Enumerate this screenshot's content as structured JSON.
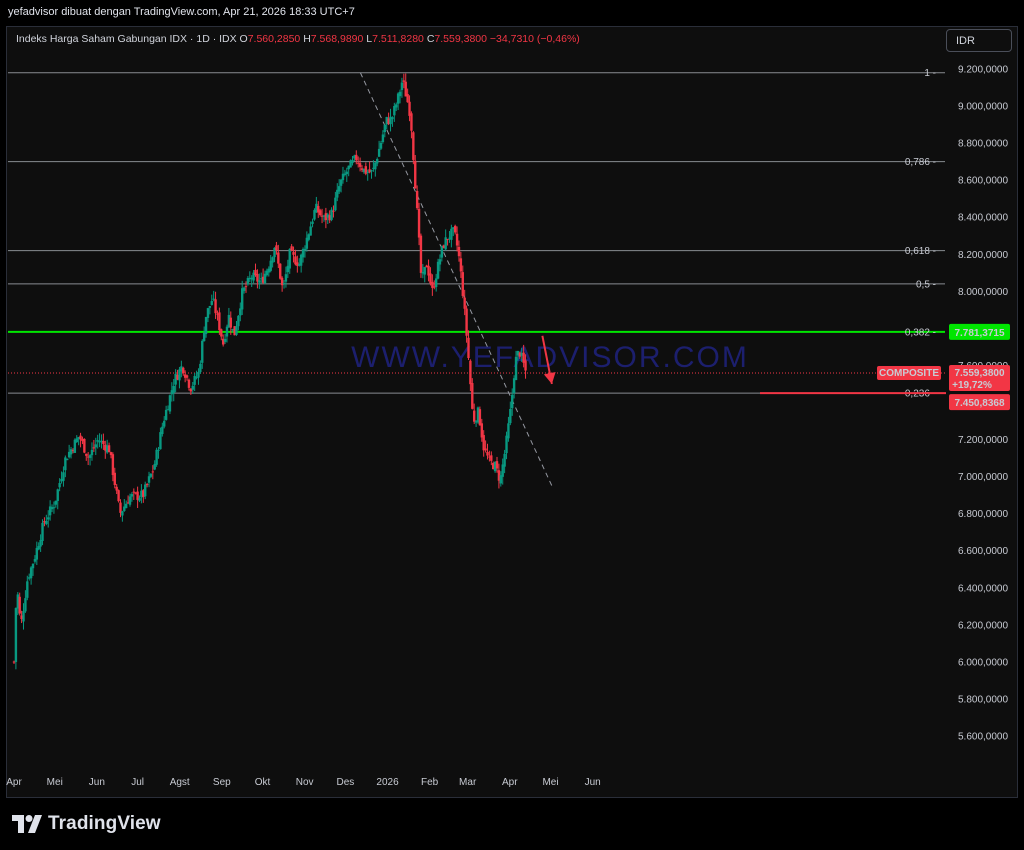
{
  "header": {
    "credit": "yefadvisor dibuat dengan TradingView.com, Apr 21, 2026 18:33 UTC+7",
    "symbol": "Indeks Harga Saham Gabungan IDX · 1D · IDX",
    "o_label": "O",
    "o_value": "7.560,2850",
    "h_label": "H",
    "h_value": "7.568,9890",
    "l_label": "L",
    "l_value": "7.511,8280",
    "c_label": "C",
    "c_value": "7.559,3800",
    "change": "−34,7310 (−0,46%)",
    "currency_button": "IDR"
  },
  "footer": {
    "logo_text": "TradingView"
  },
  "colors": {
    "up": "#089981",
    "down": "#f23645",
    "fib": "#b2b5be",
    "fib382": "#00e600",
    "bg": "#0e0e0e"
  },
  "chart_data": {
    "type": "candlestick",
    "title": "Indeks Harga Saham Gabungan IDX",
    "interval": "1D",
    "currency": "IDR",
    "y_range": [
      5500,
      9300
    ],
    "y_ticks": [
      {
        "v": 9200,
        "label": "9.200,0000"
      },
      {
        "v": 9000,
        "label": "9.000,0000"
      },
      {
        "v": 8800,
        "label": "8.800,0000"
      },
      {
        "v": 8600,
        "label": "8.600,0000"
      },
      {
        "v": 8400,
        "label": "8.400,0000"
      },
      {
        "v": 8200,
        "label": "8.200,0000"
      },
      {
        "v": 8000,
        "label": "8.000,0000"
      },
      {
        "v": 7800,
        "label": "7.800,0000"
      },
      {
        "v": 7600,
        "label": "7.600,0000"
      },
      {
        "v": 7400,
        "label": "7.400,0000"
      },
      {
        "v": 7200,
        "label": "7.200,0000"
      },
      {
        "v": 7000,
        "label": "7.000,0000"
      },
      {
        "v": 6800,
        "label": "6.800,0000"
      },
      {
        "v": 6600,
        "label": "6.600,0000"
      },
      {
        "v": 6400,
        "label": "6.400,0000"
      },
      {
        "v": 6200,
        "label": "6.200,0000"
      },
      {
        "v": 6000,
        "label": "6.000,0000"
      },
      {
        "v": 5800,
        "label": "5.800,0000"
      },
      {
        "v": 5600,
        "label": "5.600,0000"
      }
    ],
    "x_ticks": [
      {
        "label": "Apr",
        "d": 0
      },
      {
        "label": "Mei",
        "d": 30
      },
      {
        "label": "Jun",
        "d": 61
      },
      {
        "label": "Jul",
        "d": 91
      },
      {
        "label": "Agst",
        "d": 122
      },
      {
        "label": "Sep",
        "d": 153
      },
      {
        "label": "Okt",
        "d": 183
      },
      {
        "label": "Nov",
        "d": 214
      },
      {
        "label": "Des",
        "d": 244
      },
      {
        "label": "2026",
        "d": 275
      },
      {
        "label": "Feb",
        "d": 306
      },
      {
        "label": "Mar",
        "d": 334
      },
      {
        "label": "Apr",
        "d": 365
      },
      {
        "label": "Mei",
        "d": 395
      },
      {
        "label": "Jun",
        "d": 426
      }
    ],
    "fib_levels": [
      {
        "ratio": "1",
        "value": 9180
      },
      {
        "ratio": "0,786",
        "value": 8700
      },
      {
        "ratio": "0,618",
        "value": 8220
      },
      {
        "ratio": "0,5",
        "value": 8040
      },
      {
        "ratio": "0,382",
        "value": 7781.3715,
        "highlight": true
      },
      {
        "ratio": "0,236",
        "value": 7450.8368
      }
    ],
    "price_tags": [
      {
        "label": "7.781,3715",
        "value": 7781.3715,
        "color": "#00e600",
        "text_color": "#000000"
      },
      {
        "label": "COMPOSITE",
        "value": 7559.38,
        "color": "#f23645",
        "text_color": "#ffffff"
      },
      {
        "label": "7.559,3800",
        "value": 7559.38,
        "color": "#f23645",
        "text_color": "#ffffff"
      },
      {
        "label": "+19,72%",
        "value": 7559.38,
        "color": "#f23645",
        "text_color": "#ffffff"
      },
      {
        "label": "7.450,8368",
        "value": 7450.8368,
        "color": "#f23645",
        "text_color": "#ffffff"
      }
    ],
    "current_price": 7559.38,
    "trendline": {
      "from": {
        "d": 255,
        "v": 9180
      },
      "to": {
        "d": 396,
        "v": 6950
      }
    },
    "arrow": {
      "from": {
        "d": 389,
        "v": 7760
      },
      "to": {
        "d": 396,
        "v": 7500
      }
    },
    "watermark": "WWW.YEFADVISOR.COM",
    "path": [
      {
        "d": 0,
        "v": 6000
      },
      {
        "d": 2,
        "v": 6420
      },
      {
        "d": 5,
        "v": 6190
      },
      {
        "d": 10,
        "v": 6450
      },
      {
        "d": 15,
        "v": 6560
      },
      {
        "d": 22,
        "v": 6750
      },
      {
        "d": 30,
        "v": 6860
      },
      {
        "d": 38,
        "v": 7100
      },
      {
        "d": 48,
        "v": 7220
      },
      {
        "d": 55,
        "v": 7100
      },
      {
        "d": 62,
        "v": 7200
      },
      {
        "d": 70,
        "v": 7150
      },
      {
        "d": 78,
        "v": 6800
      },
      {
        "d": 85,
        "v": 6890
      },
      {
        "d": 95,
        "v": 6900
      },
      {
        "d": 103,
        "v": 7050
      },
      {
        "d": 110,
        "v": 7300
      },
      {
        "d": 118,
        "v": 7520
      },
      {
        "d": 124,
        "v": 7600
      },
      {
        "d": 130,
        "v": 7480
      },
      {
        "d": 136,
        "v": 7560
      },
      {
        "d": 141,
        "v": 7860
      },
      {
        "d": 146,
        "v": 7960
      },
      {
        "d": 150,
        "v": 7850
      },
      {
        "d": 154,
        "v": 7720
      },
      {
        "d": 158,
        "v": 7870
      },
      {
        "d": 162,
        "v": 7760
      },
      {
        "d": 168,
        "v": 7990
      },
      {
        "d": 175,
        "v": 8080
      },
      {
        "d": 182,
        "v": 8050
      },
      {
        "d": 188,
        "v": 8150
      },
      {
        "d": 192,
        "v": 8250
      },
      {
        "d": 198,
        "v": 8000
      },
      {
        "d": 203,
        "v": 8200
      },
      {
        "d": 210,
        "v": 8150
      },
      {
        "d": 217,
        "v": 8320
      },
      {
        "d": 222,
        "v": 8450
      },
      {
        "d": 228,
        "v": 8390
      },
      {
        "d": 234,
        "v": 8420
      },
      {
        "d": 240,
        "v": 8580
      },
      {
        "d": 246,
        "v": 8660
      },
      {
        "d": 252,
        "v": 8720
      },
      {
        "d": 258,
        "v": 8650
      },
      {
        "d": 264,
        "v": 8640
      },
      {
        "d": 270,
        "v": 8800
      },
      {
        "d": 274,
        "v": 8920
      },
      {
        "d": 278,
        "v": 8930
      },
      {
        "d": 283,
        "v": 9050
      },
      {
        "d": 286,
        "v": 9140
      },
      {
        "d": 289,
        "v": 9050
      },
      {
        "d": 292,
        "v": 8950
      },
      {
        "d": 296,
        "v": 8520
      },
      {
        "d": 300,
        "v": 8050
      },
      {
        "d": 304,
        "v": 8150
      },
      {
        "d": 308,
        "v": 8000
      },
      {
        "d": 312,
        "v": 8130
      },
      {
        "d": 316,
        "v": 8250
      },
      {
        "d": 320,
        "v": 8300
      },
      {
        "d": 324,
        "v": 8320
      },
      {
        "d": 327,
        "v": 8220
      },
      {
        "d": 330,
        "v": 8030
      },
      {
        "d": 334,
        "v": 7700
      },
      {
        "d": 338,
        "v": 7300
      },
      {
        "d": 342,
        "v": 7350
      },
      {
        "d": 346,
        "v": 7150
      },
      {
        "d": 350,
        "v": 7080
      },
      {
        "d": 354,
        "v": 7060
      },
      {
        "d": 358,
        "v": 6980
      },
      {
        "d": 362,
        "v": 7160
      },
      {
        "d": 366,
        "v": 7380
      },
      {
        "d": 369,
        "v": 7620
      },
      {
        "d": 372,
        "v": 7680
      },
      {
        "d": 375,
        "v": 7610
      },
      {
        "d": 377,
        "v": 7559
      }
    ]
  }
}
